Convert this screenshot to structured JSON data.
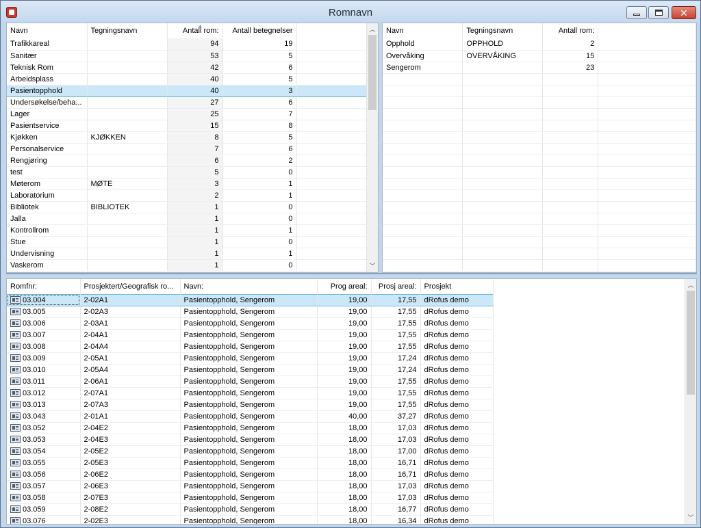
{
  "window": {
    "title": "Romnavn",
    "controls": {
      "minimize": "minimize-icon",
      "maximize": "maximize-icon",
      "close": "close-icon"
    }
  },
  "top_left": {
    "columns": [
      "Navn",
      "Tegningsnavn",
      "Antall rom:",
      "Antall betegnelser"
    ],
    "sorted_column": "Antall rom:",
    "selected_row": "Pasientopphold",
    "rows": [
      {
        "navn": "Trafikkareal",
        "tegningsnavn": "",
        "antall_rom": "94",
        "antall_betegnelser": "19"
      },
      {
        "navn": "Sanitær",
        "tegningsnavn": "",
        "antall_rom": "53",
        "antall_betegnelser": "5"
      },
      {
        "navn": "Teknisk Rom",
        "tegningsnavn": "",
        "antall_rom": "42",
        "antall_betegnelser": "6"
      },
      {
        "navn": "Arbeidsplass",
        "tegningsnavn": "",
        "antall_rom": "40",
        "antall_betegnelser": "5"
      },
      {
        "navn": "Pasientopphold",
        "tegningsnavn": "",
        "antall_rom": "40",
        "antall_betegnelser": "3"
      },
      {
        "navn": "Undersøkelse/beha...",
        "tegningsnavn": "",
        "antall_rom": "27",
        "antall_betegnelser": "6"
      },
      {
        "navn": "Lager",
        "tegningsnavn": "",
        "antall_rom": "25",
        "antall_betegnelser": "7"
      },
      {
        "navn": "Pasientservice",
        "tegningsnavn": "",
        "antall_rom": "15",
        "antall_betegnelser": "8"
      },
      {
        "navn": "Kjøkken",
        "tegningsnavn": "KJØKKEN",
        "antall_rom": "8",
        "antall_betegnelser": "5"
      },
      {
        "navn": "Personalservice",
        "tegningsnavn": "",
        "antall_rom": "7",
        "antall_betegnelser": "6"
      },
      {
        "navn": "Rengjøring",
        "tegningsnavn": "",
        "antall_rom": "6",
        "antall_betegnelser": "2"
      },
      {
        "navn": "test",
        "tegningsnavn": "",
        "antall_rom": "5",
        "antall_betegnelser": "0"
      },
      {
        "navn": "Møterom",
        "tegningsnavn": "MØTE",
        "antall_rom": "3",
        "antall_betegnelser": "1"
      },
      {
        "navn": "Laboratorium",
        "tegningsnavn": "",
        "antall_rom": "2",
        "antall_betegnelser": "1"
      },
      {
        "navn": "Bibliotek",
        "tegningsnavn": "BIBLIOTEK",
        "antall_rom": "1",
        "antall_betegnelser": "0"
      },
      {
        "navn": "Jalla",
        "tegningsnavn": "",
        "antall_rom": "1",
        "antall_betegnelser": "0"
      },
      {
        "navn": "Kontrollrom",
        "tegningsnavn": "",
        "antall_rom": "1",
        "antall_betegnelser": "1"
      },
      {
        "navn": "Stue",
        "tegningsnavn": "",
        "antall_rom": "1",
        "antall_betegnelser": "0"
      },
      {
        "navn": "Undervisning",
        "tegningsnavn": "",
        "antall_rom": "1",
        "antall_betegnelser": "1"
      },
      {
        "navn": "Vaskerom",
        "tegningsnavn": "",
        "antall_rom": "1",
        "antall_betegnelser": "0"
      }
    ]
  },
  "top_right": {
    "columns": [
      "Navn",
      "Tegningsnavn",
      "Antall rom:"
    ],
    "rows": [
      {
        "navn": "Opphold",
        "tegningsnavn": "OPPHOLD",
        "antall_rom": "2"
      },
      {
        "navn": "Overvåking",
        "tegningsnavn": "OVERVÅKING",
        "antall_rom": "15"
      },
      {
        "navn": "Sengerom",
        "tegningsnavn": "",
        "antall_rom": "23"
      }
    ]
  },
  "bottom": {
    "columns": [
      "Romfnr:",
      "Prosjektert/Geografisk ro...",
      "Navn:",
      "Prog areal:",
      "Prosj areal:",
      "Prosjekt"
    ],
    "row_icon": "room-icon",
    "rows": [
      {
        "romfnr": "03.004",
        "geo": "2-02A1",
        "navn": "Pasientopphold, Sengerom",
        "prog": "19,00",
        "prosj": "17,55",
        "prosjekt": "dRofus demo"
      },
      {
        "romfnr": "03.005",
        "geo": "2-02A3",
        "navn": "Pasientopphold, Sengerom",
        "prog": "19,00",
        "prosj": "17,55",
        "prosjekt": "dRofus demo"
      },
      {
        "romfnr": "03.006",
        "geo": "2-03A1",
        "navn": "Pasientopphold, Sengerom",
        "prog": "19,00",
        "prosj": "17,55",
        "prosjekt": "dRofus demo"
      },
      {
        "romfnr": "03.007",
        "geo": "2-04A1",
        "navn": "Pasientopphold, Sengerom",
        "prog": "19,00",
        "prosj": "17,55",
        "prosjekt": "dRofus demo"
      },
      {
        "romfnr": "03.008",
        "geo": "2-04A4",
        "navn": "Pasientopphold, Sengerom",
        "prog": "19,00",
        "prosj": "17,55",
        "prosjekt": "dRofus demo"
      },
      {
        "romfnr": "03.009",
        "geo": "2-05A1",
        "navn": "Pasientopphold, Sengerom",
        "prog": "19,00",
        "prosj": "17,24",
        "prosjekt": "dRofus demo"
      },
      {
        "romfnr": "03.010",
        "geo": "2-05A4",
        "navn": "Pasientopphold, Sengerom",
        "prog": "19,00",
        "prosj": "17,24",
        "prosjekt": "dRofus demo"
      },
      {
        "romfnr": "03.011",
        "geo": "2-06A1",
        "navn": "Pasientopphold, Sengerom",
        "prog": "19,00",
        "prosj": "17,55",
        "prosjekt": "dRofus demo"
      },
      {
        "romfnr": "03.012",
        "geo": "2-07A1",
        "navn": "Pasientopphold, Sengerom",
        "prog": "19,00",
        "prosj": "17,55",
        "prosjekt": "dRofus demo"
      },
      {
        "romfnr": "03.013",
        "geo": "2-07A3",
        "navn": "Pasientopphold, Sengerom",
        "prog": "19,00",
        "prosj": "17,55",
        "prosjekt": "dRofus demo"
      },
      {
        "romfnr": "03.043",
        "geo": "2-01A1",
        "navn": "Pasientopphold, Sengerom",
        "prog": "40,00",
        "prosj": "37,27",
        "prosjekt": "dRofus demo"
      },
      {
        "romfnr": "03.052",
        "geo": "2-04E2",
        "navn": "Pasientopphold, Sengerom",
        "prog": "18,00",
        "prosj": "17,03",
        "prosjekt": "dRofus demo"
      },
      {
        "romfnr": "03.053",
        "geo": "2-04E3",
        "navn": "Pasientopphold, Sengerom",
        "prog": "18,00",
        "prosj": "17,03",
        "prosjekt": "dRofus demo"
      },
      {
        "romfnr": "03.054",
        "geo": "2-05E2",
        "navn": "Pasientopphold, Sengerom",
        "prog": "18,00",
        "prosj": "17,00",
        "prosjekt": "dRofus demo"
      },
      {
        "romfnr": "03.055",
        "geo": "2-05E3",
        "navn": "Pasientopphold, Sengerom",
        "prog": "18,00",
        "prosj": "16,71",
        "prosjekt": "dRofus demo"
      },
      {
        "romfnr": "03.056",
        "geo": "2-06E2",
        "navn": "Pasientopphold, Sengerom",
        "prog": "18,00",
        "prosj": "16,71",
        "prosjekt": "dRofus demo"
      },
      {
        "romfnr": "03.057",
        "geo": "2-06E3",
        "navn": "Pasientopphold, Sengerom",
        "prog": "18,00",
        "prosj": "17,03",
        "prosjekt": "dRofus demo"
      },
      {
        "romfnr": "03.058",
        "geo": "2-07E3",
        "navn": "Pasientopphold, Sengerom",
        "prog": "18,00",
        "prosj": "17,03",
        "prosjekt": "dRofus demo"
      },
      {
        "romfnr": "03.059",
        "geo": "2-08E2",
        "navn": "Pasientopphold, Sengerom",
        "prog": "18,00",
        "prosj": "16,77",
        "prosjekt": "dRofus demo"
      },
      {
        "romfnr": "03.076",
        "geo": "2-02E3",
        "navn": "Pasientopphold, Sengerom",
        "prog": "18,00",
        "prosj": "16,34",
        "prosjekt": "dRofus demo"
      }
    ]
  }
}
